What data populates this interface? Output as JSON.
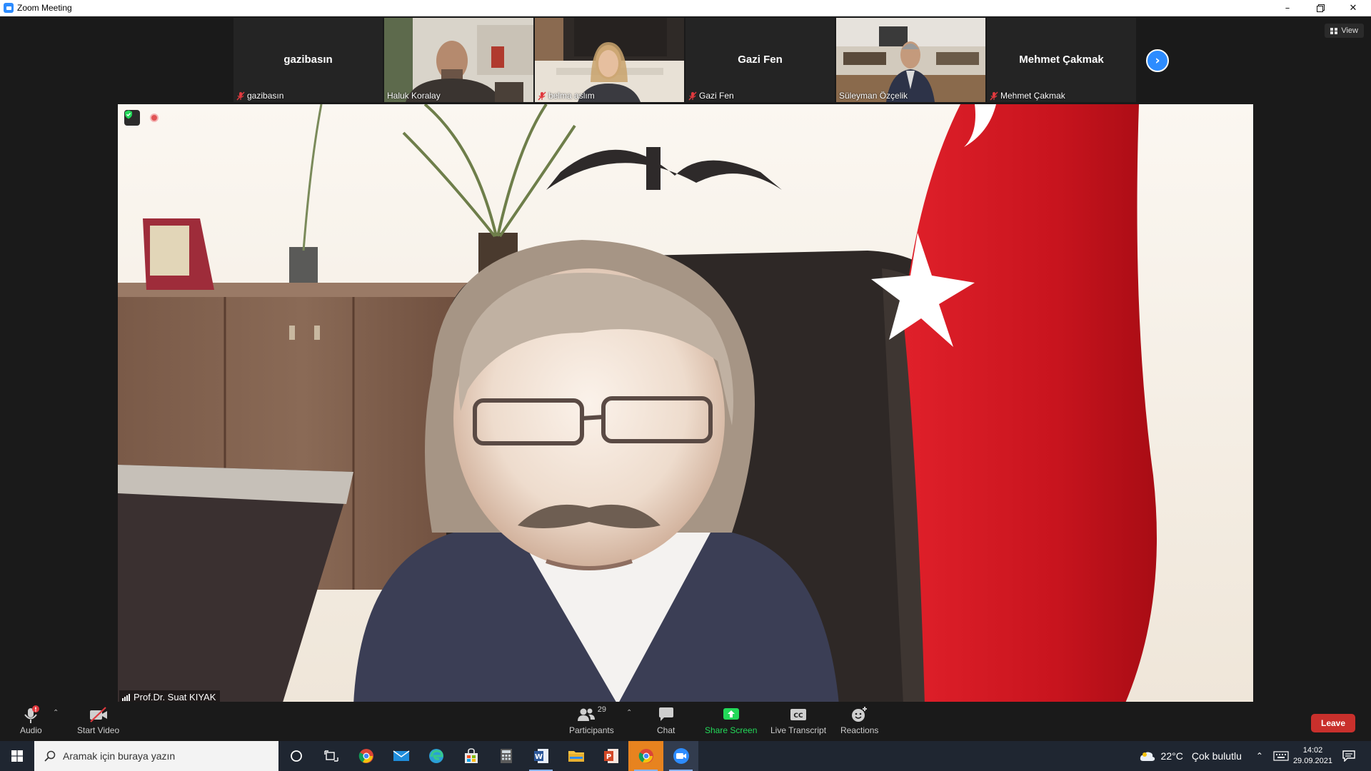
{
  "window": {
    "title": "Zoom Meeting",
    "controls": [
      "minimize",
      "restore",
      "close"
    ]
  },
  "view_button": {
    "label": "View"
  },
  "thumbnails": [
    {
      "display_name": "gazibasın",
      "label": "gazibasın",
      "video": false,
      "muted": true
    },
    {
      "display_name": "",
      "label": "Haluk Koralay",
      "video": true,
      "muted": false
    },
    {
      "display_name": "",
      "label": "belma aslım",
      "video": true,
      "muted": true
    },
    {
      "display_name": "Gazi Fen",
      "label": "Gazi Fen",
      "video": false,
      "muted": true
    },
    {
      "display_name": "",
      "label": "Süleyman Özçelik",
      "video": true,
      "muted": false
    },
    {
      "display_name": "Mehmet Çakmak",
      "label": "Mehmet Çakmak",
      "video": false,
      "muted": true
    }
  ],
  "main_speaker": {
    "name": "Prof.Dr. Suat KIYAK"
  },
  "toolbar": {
    "audio_label": "Audio",
    "start_video_label": "Start Video",
    "participants_label": "Participants",
    "participants_count": "29",
    "chat_label": "Chat",
    "share_screen_label": "Share Screen",
    "live_transcript_label": "Live Transcript",
    "reactions_label": "Reactions",
    "leave_label": "Leave"
  },
  "taskbar": {
    "search_placeholder": "Aramak için buraya yazın",
    "weather_temp": "22°C",
    "weather_text": "Çok bulutlu",
    "time": "14:02",
    "date": "29.09.2021"
  },
  "colors": {
    "zoom_blue": "#2d8cff",
    "share_green": "#23d959",
    "leave_red": "#c9302c",
    "mute_red": "#e0393e"
  }
}
